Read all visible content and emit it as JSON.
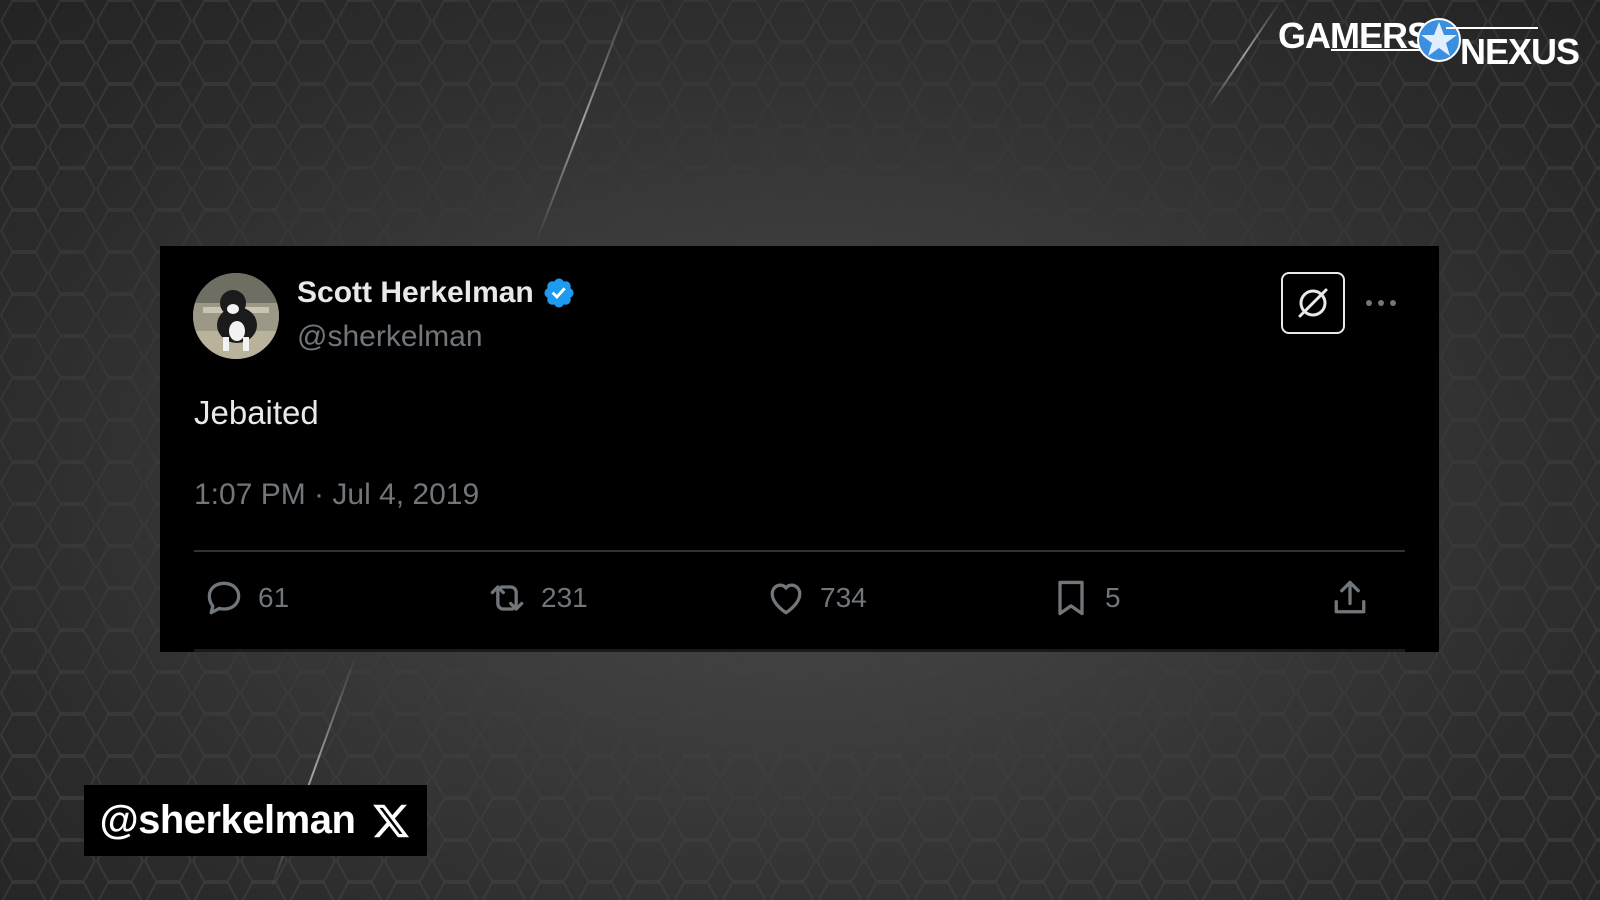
{
  "logo": {
    "text_left": "GAMERS",
    "text_right": "NEXUS",
    "icon": "gamers-nexus-star-icon"
  },
  "tweet": {
    "display_name": "Scott Herkelman",
    "verified": true,
    "verified_icon": "verified-badge-icon",
    "handle": "@sherkelman",
    "text": "Jebaited",
    "timestamp": "1:07 PM · Jul 4, 2019",
    "grok_icon": "grok-icon",
    "more_icon": "more-dots-icon",
    "actions": {
      "reply": {
        "icon": "reply-icon",
        "count": "61"
      },
      "repost": {
        "icon": "repost-icon",
        "count": "231"
      },
      "like": {
        "icon": "heart-icon",
        "count": "734"
      },
      "bookmark": {
        "icon": "bookmark-icon",
        "count": "5"
      },
      "share": {
        "icon": "share-icon"
      }
    }
  },
  "handle_badge": {
    "text": "@sherkelman",
    "icon": "x-logo-icon"
  },
  "colors": {
    "verified_blue": "#1d9bf0",
    "text_primary": "#e7e9ea",
    "text_secondary": "#71767b",
    "card_background": "#000000"
  }
}
